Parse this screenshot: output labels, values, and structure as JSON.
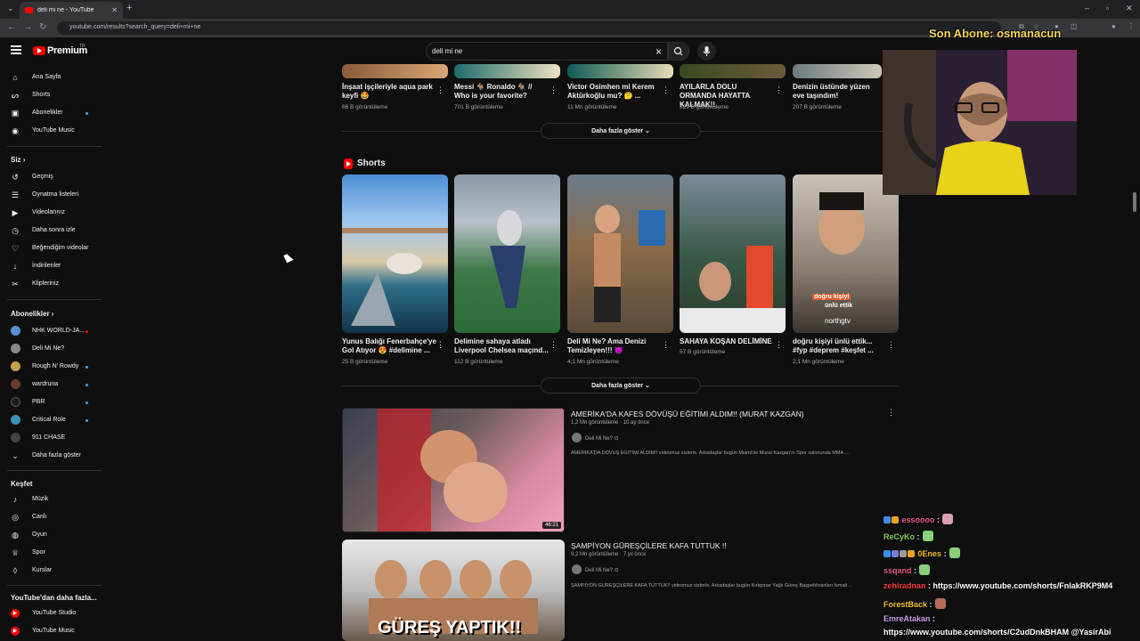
{
  "browser": {
    "tab_title": "deli mi ne - YouTube",
    "url": "youtube.com/results?search_query=deli+mi+ne"
  },
  "header": {
    "logo_text": "Premium",
    "logo_sup": "TR",
    "search_value": "deli mi ne"
  },
  "sidebar": {
    "main": [
      {
        "label": "Ana Sayfa",
        "icon": "home-icon"
      },
      {
        "label": "Shorts",
        "icon": "shorts-icon"
      },
      {
        "label": "Abonelikler",
        "icon": "subscriptions-icon"
      },
      {
        "label": "YouTube Music",
        "icon": "music-icon"
      }
    ],
    "you_heading": "Siz",
    "you": [
      {
        "label": "Geçmiş",
        "icon": "history-icon"
      },
      {
        "label": "Oynatma listeleri",
        "icon": "playlist-icon"
      },
      {
        "label": "Videolarınız",
        "icon": "your-videos-icon"
      },
      {
        "label": "Daha sonra izle",
        "icon": "watch-later-icon"
      },
      {
        "label": "Beğendiğim videolar",
        "icon": "like-icon"
      },
      {
        "label": "İndirilenler",
        "icon": "download-icon"
      },
      {
        "label": "Klipleriniz",
        "icon": "clips-icon"
      }
    ],
    "subs_heading": "Abonelikler",
    "subs": [
      {
        "label": "NHK WORLD-JA...",
        "color": "#5a8fd6",
        "live": true
      },
      {
        "label": "Deli Mi Ne?",
        "color": "#888888",
        "live": false
      },
      {
        "label": "Rough N' Rowdy",
        "color": "#c9a24a",
        "live": true
      },
      {
        "label": "wardruna",
        "color": "#6b3a2a",
        "live": true
      },
      {
        "label": "PBR",
        "color": "#1e1e1e",
        "live": true
      },
      {
        "label": "Critical Role",
        "color": "#3a8fb7",
        "live": true
      },
      {
        "label": "911 CHASE",
        "color": "#444444",
        "live": false
      }
    ],
    "subs_more": "Daha fazla göster",
    "explore_heading": "Keşfet",
    "explore": [
      {
        "label": "Müzik",
        "icon": "music-note-icon"
      },
      {
        "label": "Canlı",
        "icon": "live-icon"
      },
      {
        "label": "Oyun",
        "icon": "gaming-icon"
      },
      {
        "label": "Spor",
        "icon": "trophy-icon"
      },
      {
        "label": "Kurslar",
        "icon": "courses-icon"
      }
    ],
    "more_heading": "YouTube'dan daha fazla...",
    "more": [
      {
        "label": "YouTube Studio"
      },
      {
        "label": "YouTube Music"
      }
    ]
  },
  "top_row": [
    {
      "title": "İnşaat işçileriyle aqua park keyfi 🤩",
      "views": "66 B görüntüleme"
    },
    {
      "title": "Messi 🐐 Ronaldo 🐐 // Who is your favorite?",
      "views": "701 B görüntüleme"
    },
    {
      "title": "Victor Osimhen mi Kerem Aktürkoğlu mu? 🤔 ...",
      "views": "11 Mn görüntüleme"
    },
    {
      "title": "AYILARLA DOLU ORMANDA HAYATTA KALMAK!!",
      "views": "229 B görüntüleme"
    },
    {
      "title": "Denizin üstünde yüzen eve taşındım!",
      "views": "207 B görüntüleme"
    }
  ],
  "show_more": "Daha fazla göster",
  "shorts_heading": "Shorts",
  "shorts": [
    {
      "title": "Yunus Balığı Fenerbahçe'ye Gol Atıyor 😍 #delimine ...",
      "views": "25 B görüntüleme"
    },
    {
      "title": "Delimine sahaya atladı Liverpool Chelsea maçınd...",
      "views": "112 B görüntüleme"
    },
    {
      "title": "Deli Mi Ne? Ama Denizi Temizleyen!!! 😈",
      "views": "4,1 Mn görüntüleme"
    },
    {
      "title": "SAHAYA KOŞAN DELİMİNE",
      "views": "57 B görüntüleme"
    },
    {
      "title": "doğru kişiyi ünlü ettik... #fyp #deprem #keşfet ...",
      "views": "2,1 Mn görüntüleme"
    }
  ],
  "shorts_overlay": {
    "line1": "doğru kişiyi",
    "line2": "ünlü ettik",
    "brand": "northgtv"
  },
  "videos": [
    {
      "title": "AMERİKA'DA KAFES DÖVÜŞÜ EĞİTİMİ ALDIM!! (MURAT KAZGAN)",
      "meta": "1,2 Mn görüntüleme · 10 ay önce",
      "channel": "Deli Mi Ne? ⊙",
      "desc": "AMERİKA'DA DÖVÜŞ EĞİTİMİ ALDIM!! videomuz sizlerle. Arkadaşlar bugün Miami'de Murat Kazgan'ın Spor salonunda MMA ...",
      "duration": "46:21"
    },
    {
      "title": "ŞAMPİYON GÜREŞÇİLERE KAFA TUTTUK !!",
      "meta": "9,2 Mn görüntüleme · 7 yıl önce",
      "channel": "Deli Mi Ne? ⊙",
      "desc": "ŞAMPİYON GÜREŞÇİLERE KAFA TUTTUK!! videomuz sizlerle. Arkadaşlar bugün Kırkpınar Yağlı Güreş Başpehlivanları İsmail ...",
      "thumb_text": "GÜREŞ YAPTIK!!"
    }
  ],
  "stream": {
    "son_abone": "Son Abone: osmanacun",
    "chat": [
      {
        "user": "essoooo",
        "color": "#e85a8a",
        "text": ":"
      },
      {
        "user": "ReCyKo",
        "color": "#7fd35a",
        "text": ":"
      },
      {
        "user": "0Enes",
        "color": "#f2c12e",
        "text": ":"
      },
      {
        "user": "ssqand",
        "color": "#e85a8a",
        "text": ":"
      },
      {
        "user": "zehiradnan",
        "color": "#ff3b3b",
        "text": ": https://www.youtube.com/shorts/FnlakRKP9M4"
      },
      {
        "user": "ForestBack",
        "color": "#f2c12e",
        "text": ":"
      },
      {
        "user": "EmreAtakan",
        "color": "#c8a0e8",
        "text": ":"
      },
      {
        "user": "",
        "color": "#ffffff",
        "text": "https://www.youtube.com/shorts/C2udDnkBHAM @YasirAbi"
      }
    ]
  }
}
